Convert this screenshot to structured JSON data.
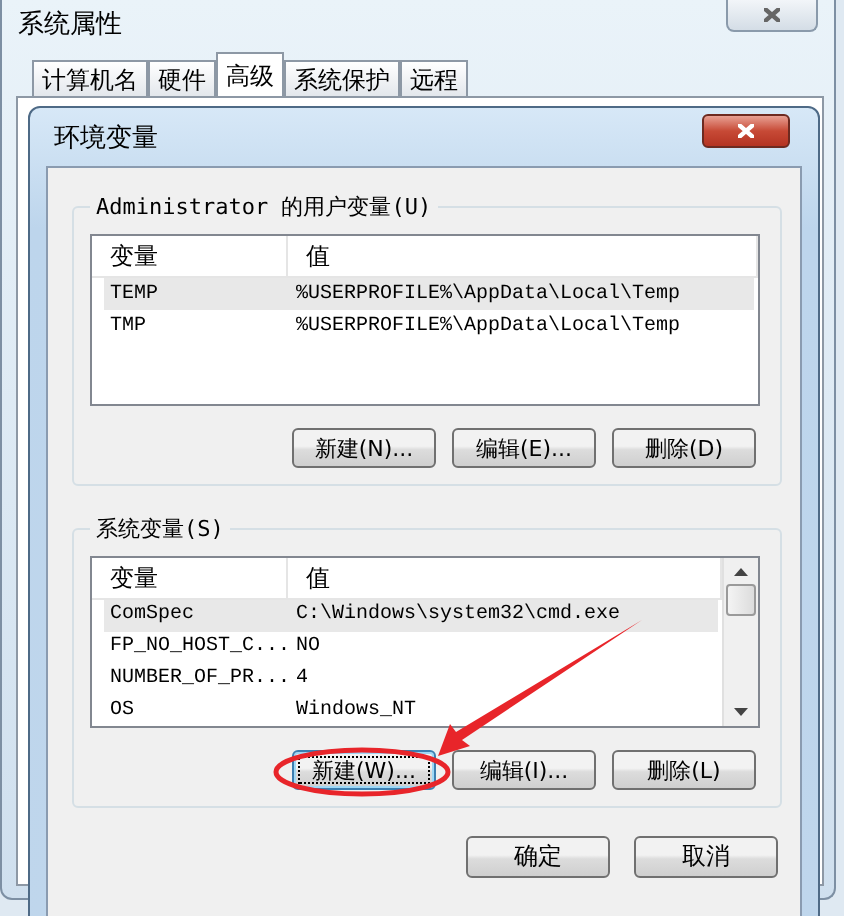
{
  "outer_window": {
    "title": "系统属性",
    "tabs": [
      {
        "label": "计算机名",
        "selected": false
      },
      {
        "label": "硬件",
        "selected": false
      },
      {
        "label": "高级",
        "selected": true
      },
      {
        "label": "系统保护",
        "selected": false
      },
      {
        "label": "远程",
        "selected": false
      }
    ]
  },
  "dialog": {
    "title": "环境变量",
    "user_vars": {
      "label": "Administrator 的用户变量(U)",
      "columns": [
        "变量",
        "值"
      ],
      "rows": [
        {
          "name": "TEMP",
          "value": "%USERPROFILE%\\AppData\\Local\\Temp",
          "selected": true
        },
        {
          "name": "TMP",
          "value": "%USERPROFILE%\\AppData\\Local\\Temp",
          "selected": false
        }
      ],
      "buttons": [
        {
          "label": "新建(N)...",
          "focused": false,
          "highlighted": false
        },
        {
          "label": "编辑(E)...",
          "focused": false,
          "highlighted": false
        },
        {
          "label": "删除(D)",
          "focused": false,
          "highlighted": false
        }
      ]
    },
    "system_vars": {
      "label": "系统变量(S)",
      "columns": [
        "变量",
        "值"
      ],
      "rows": [
        {
          "name": "ComSpec",
          "value": "C:\\Windows\\system32\\cmd.exe",
          "selected": true
        },
        {
          "name": "FP_NO_HOST_C...",
          "value": "NO",
          "selected": false
        },
        {
          "name": "NUMBER_OF_PR...",
          "value": "4",
          "selected": false
        },
        {
          "name": "OS",
          "value": "Windows_NT",
          "selected": false
        }
      ],
      "buttons": [
        {
          "label": "新建(W)...",
          "focused": true,
          "highlighted": true
        },
        {
          "label": "编辑(I)...",
          "focused": false,
          "highlighted": false
        },
        {
          "label": "删除(L)",
          "focused": false,
          "highlighted": false
        }
      ]
    },
    "buttons": [
      "确定",
      "取消"
    ]
  }
}
